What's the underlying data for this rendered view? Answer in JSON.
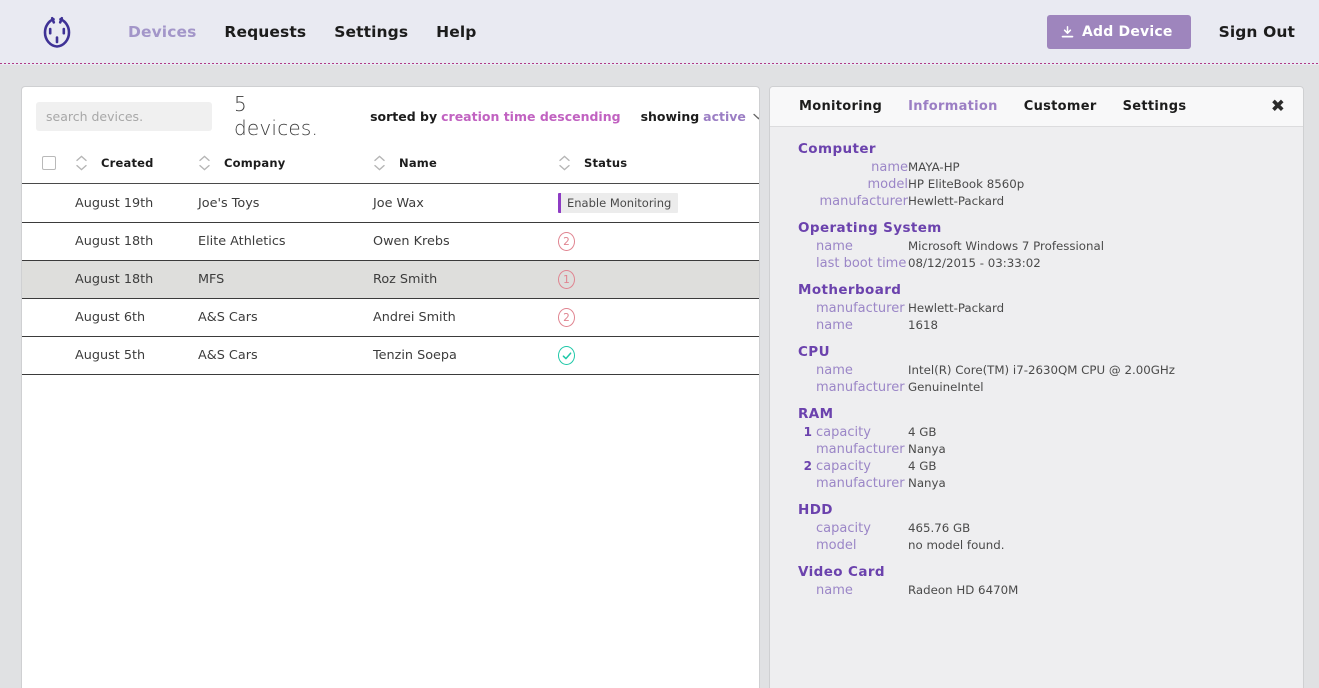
{
  "nav": {
    "logo_icon": "broken-circle-logo-icon",
    "links": [
      {
        "label": "Devices",
        "active": true
      },
      {
        "label": "Requests",
        "active": false
      },
      {
        "label": "Settings",
        "active": false
      },
      {
        "label": "Help",
        "active": false
      }
    ],
    "add_device_label": "Add Device",
    "add_device_icon": "download-icon",
    "sign_out_label": "Sign Out",
    "accent_color": "#9e85bd",
    "active_link_color": "#a396c9"
  },
  "list": {
    "search_placeholder": "search devices.",
    "search_value": "",
    "device_count_label": "5 devices.",
    "sorted_by_label": "sorted by",
    "sorted_by_value": "creation time descending",
    "showing_label": "showing",
    "showing_value": "active",
    "showing_caret_icon": "chevron-down-icon",
    "columns": [
      {
        "label": "",
        "key": "checkbox"
      },
      {
        "label": "Created",
        "key": "created"
      },
      {
        "label": "Company",
        "key": "company"
      },
      {
        "label": "Name",
        "key": "name"
      },
      {
        "label": "Status",
        "key": "status"
      }
    ],
    "rows": [
      {
        "created": "August 19th",
        "company": "Joe's Toys",
        "name": "Joe Wax",
        "status_type": "action",
        "status_label": "Enable Monitoring",
        "selected": false
      },
      {
        "created": "August 18th",
        "company": "Elite Athletics",
        "name": "Owen Krebs",
        "status_type": "count",
        "status_label": "2",
        "selected": false
      },
      {
        "created": "August 18th",
        "company": "MFS",
        "name": "Roz Smith",
        "status_type": "count",
        "status_label": "1",
        "selected": true
      },
      {
        "created": "August 6th",
        "company": "A&S Cars",
        "name": "Andrei Smith",
        "status_type": "count",
        "status_label": "2",
        "selected": false
      },
      {
        "created": "August 5th",
        "company": "A&S Cars",
        "name": "Tenzin Soepa",
        "status_type": "ok",
        "status_label": "✓",
        "selected": false
      }
    ],
    "status_count_color": "#e08490",
    "status_ok_color": "#1fc8a8"
  },
  "detail": {
    "tabs": [
      {
        "label": "Monitoring",
        "active": false
      },
      {
        "label": "Information",
        "active": true
      },
      {
        "label": "Customer",
        "active": false
      },
      {
        "label": "Settings",
        "active": false
      }
    ],
    "close_icon": "close-icon",
    "sections": [
      {
        "title": "Computer",
        "value_offset": 98,
        "key_align": "right",
        "key_width": 92,
        "rows": [
          {
            "key": "name",
            "value": "MAYA-HP"
          },
          {
            "key": "model",
            "value": "HP EliteBook 8560p"
          },
          {
            "key": "manufacturer",
            "value": "Hewlett-Packard"
          }
        ]
      },
      {
        "title": "Operating System",
        "value_offset": 98,
        "key_align": "left",
        "key_width": 92,
        "rows": [
          {
            "key": "name",
            "value": "Microsoft Windows 7 Professional"
          },
          {
            "key": "last boot time",
            "value": "08/12/2015 - 03:33:02"
          }
        ]
      },
      {
        "title": "Motherboard",
        "value_offset": 98,
        "key_align": "left",
        "key_width": 92,
        "rows": [
          {
            "key": "manufacturer",
            "value": "Hewlett-Packard"
          },
          {
            "key": "name",
            "value": "1618"
          }
        ]
      },
      {
        "title": "CPU",
        "value_offset": 98,
        "key_align": "left",
        "key_width": 92,
        "rows": [
          {
            "key": "name",
            "value": "Intel(R) Core(TM) i7-2630QM CPU @ 2.00GHz"
          },
          {
            "key": "manufacturer",
            "value": "GenuineIntel"
          }
        ]
      },
      {
        "title": "RAM",
        "value_offset": 110,
        "key_align": "left",
        "key_width": 92,
        "rows": [
          {
            "index": "1",
            "key": "capacity",
            "value": "4 GB"
          },
          {
            "key": "manufacturer",
            "value": "Nanya"
          },
          {
            "index": "2",
            "key": "capacity",
            "value": "4 GB"
          },
          {
            "key": "manufacturer",
            "value": "Nanya"
          }
        ]
      },
      {
        "title": "HDD",
        "value_offset": 98,
        "key_align": "left",
        "key_width": 92,
        "rows": [
          {
            "key": "capacity",
            "value": "465.76 GB"
          },
          {
            "key": "model",
            "value": "no model found."
          }
        ]
      },
      {
        "title": "Video Card",
        "value_offset": 98,
        "key_align": "left",
        "key_width": 92,
        "rows": [
          {
            "key": "name",
            "value": "Radeon HD 6470M"
          }
        ]
      }
    ],
    "section_title_color": "#6b42ad",
    "key_color": "#9b86c7",
    "value_color": "#4a4a4a"
  }
}
